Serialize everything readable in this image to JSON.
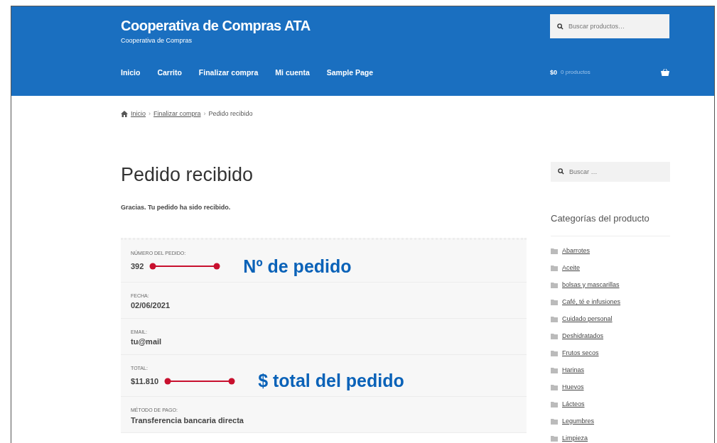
{
  "header": {
    "site_title": "Cooperativa de Compras ATA",
    "tagline": "Cooperativa de Compras",
    "search": {
      "placeholder": "Buscar productos…"
    },
    "nav": [
      {
        "label": "Inicio"
      },
      {
        "label": "Carrito"
      },
      {
        "label": "Finalizar compra"
      },
      {
        "label": "Mi cuenta"
      },
      {
        "label": "Sample Page"
      }
    ],
    "cart": {
      "amount": "$0",
      "count": "0 productos"
    }
  },
  "breadcrumb": [
    {
      "label": "Inicio",
      "link": true
    },
    {
      "separator": "›"
    },
    {
      "label": "Finalizar compra",
      "link": true
    },
    {
      "separator": "›"
    },
    {
      "label": "Pedido recibido",
      "link": false
    }
  ],
  "page_title": "Pedido recibido",
  "message": "Gracias. Tu pedido ha sido recibido.",
  "order_details": [
    {
      "label": "NÚMERO DEL PEDIDO:",
      "value": "392",
      "annotation": "Nº de pedido"
    },
    {
      "label": "FECHA:",
      "value": "02/06/2021"
    },
    {
      "label": "EMAIL:",
      "value": "tu@mail"
    },
    {
      "label": "TOTAL:",
      "value": "$11.810",
      "annotation": "$ total del pedido"
    },
    {
      "label": "MÉTODO DE PAGO:",
      "value": "Transferencia bancaria directa"
    }
  ],
  "sidebar": {
    "search": {
      "placeholder": "Buscar …"
    },
    "categories_title": "Categorías del producto",
    "categories": [
      {
        "label": "Abarrotes"
      },
      {
        "label": "Aceite"
      },
      {
        "label": "bolsas y mascarillas"
      },
      {
        "label": "Café, té e infusiones"
      },
      {
        "label": "Cuidado personal"
      },
      {
        "label": "Deshidratados"
      },
      {
        "label": "Frutos secos"
      },
      {
        "label": "Harinas"
      },
      {
        "label": "Huevos"
      },
      {
        "label": "Lácteos"
      },
      {
        "label": "Legumbres"
      },
      {
        "label": "Limpieza"
      }
    ]
  }
}
